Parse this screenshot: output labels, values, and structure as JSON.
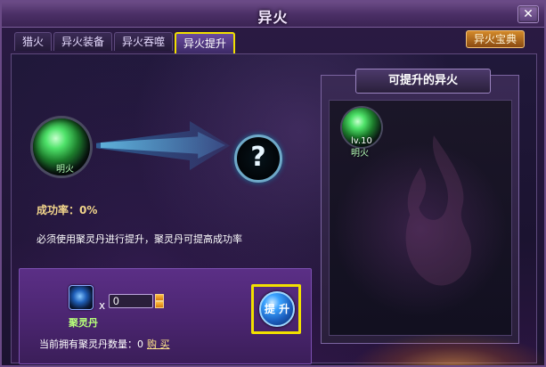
{
  "window": {
    "title": "异火",
    "close_label": "✕"
  },
  "tabs": [
    {
      "label": "猎火",
      "active": false
    },
    {
      "label": "异火装备",
      "active": false
    },
    {
      "label": "异火吞噬",
      "active": false
    },
    {
      "label": "异火提升",
      "active": true
    }
  ],
  "top_right_button": {
    "label": "异火宝典"
  },
  "left": {
    "current_fire": {
      "name": "明火",
      "icon": "green-fire-orb-icon"
    },
    "result_icon": "question-mark-icon",
    "success_rate_label": "成功率：",
    "success_rate_value": "0%",
    "hint": "必须使用聚灵丹进行提升，聚灵丹可提高成功率"
  },
  "material": {
    "name": "聚灵丹",
    "icon": "blue-orb-icon",
    "times": "x",
    "quantity": "0",
    "owned_label": "当前拥有聚灵丹数量：",
    "owned_value": "0",
    "buy_label": "购 买"
  },
  "upgrade_button": {
    "label": "提 升"
  },
  "right_panel": {
    "title": "可提升的异火",
    "items": [
      {
        "level": "lv.10",
        "name": "明火",
        "icon": "green-fire-orb-icon"
      }
    ]
  },
  "colors": {
    "highlight": "#f2e000",
    "panel_purple": "#5b2f86",
    "accent_gold": "#f2d58b",
    "accent_green": "#b7ff7a"
  }
}
